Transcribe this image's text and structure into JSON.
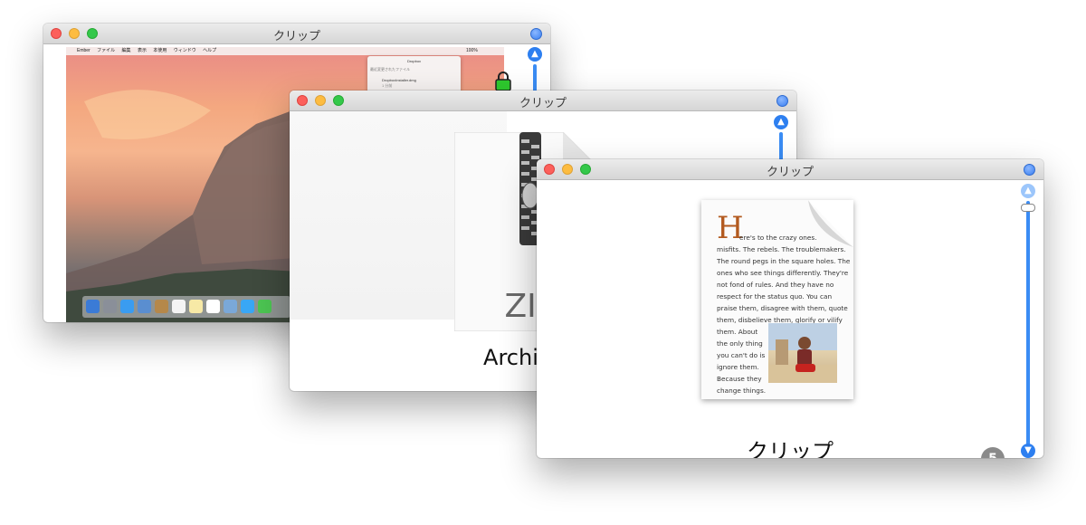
{
  "windows": [
    {
      "title": "クリップ"
    },
    {
      "title": "クリップ"
    },
    {
      "title": "クリップ"
    }
  ],
  "desktop_preview": {
    "menubar": [
      "",
      "Ember",
      "ファイル",
      "編集",
      "表示",
      "本使用",
      "ウィンドウ",
      "ヘルプ"
    ],
    "status_right": "100%",
    "dropbox_menu": {
      "title": "Dropbox",
      "header": "最近変更されたファイル",
      "item_name": "DropboxInstaller.dmg",
      "item_sub": "1 分前"
    }
  },
  "archive_preview": {
    "icon_label": "ZIP",
    "file_name": "Archive.zip"
  },
  "document_preview": {
    "drop_cap": "H",
    "lines": [
      "ere's to the crazy ones.",
      "misfits. The rebels. The troublemakers.",
      "The round pegs in the square holes. The",
      "ones who see things differently. They're",
      "not fond of rules. And they have no",
      "respect for the status quo. You can",
      "praise them, disagree with them, quote",
      "them, disbelieve them, glorify or vilify"
    ],
    "side_lines": [
      "them. About",
      "the only thing",
      "you can't do is",
      "ignore them.",
      "Because they",
      "change things."
    ],
    "file_name": "クリップ",
    "count_badge": "5"
  },
  "colors": {
    "accent": "#2d7ff0",
    "close": "#fc605b",
    "minimize": "#fdbc40",
    "maximize": "#34c84a",
    "drop_cap": "#b35a1f"
  },
  "icons": {
    "scroll_up": "chevron-up-icon",
    "scroll_down": "chevron-down-icon",
    "lock": "lock-icon"
  }
}
